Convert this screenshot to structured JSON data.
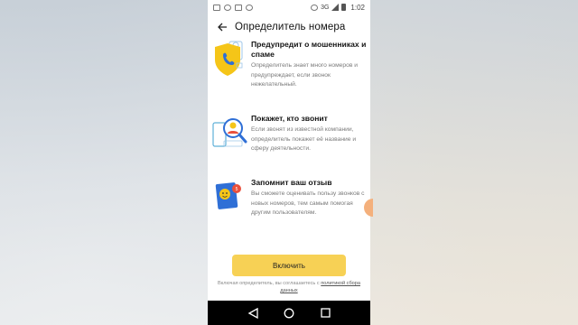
{
  "status_bar": {
    "network": "3G",
    "time": "1:02"
  },
  "app_bar": {
    "title": "Определитель номера",
    "back_icon": "arrow-left-icon"
  },
  "features": [
    {
      "icon": "shield-phone-icon",
      "title": "Предупредит о мошенниках и спаме",
      "description": "Определитель знает много номеров и предупреждает, если звонок нежелательный."
    },
    {
      "icon": "magnifier-person-icon",
      "title": "Покажет, кто звонит",
      "description": "Если звонят из известной компании, определитель покажет её название и сферу деятельности."
    },
    {
      "icon": "smiley-review-icon",
      "title": "Запомнит ваш отзыв",
      "description": "Вы сможете оценивать пользу звонков с новых номеров, тем самым помогая другим пользователям."
    }
  ],
  "cta": {
    "label": "Включить"
  },
  "legal": {
    "text": "Включая определитель, вы соглашаетесь с",
    "link": "политикой сбора данных"
  },
  "colors": {
    "accent": "#f7d155",
    "icon_yellow": "#f5c518",
    "icon_blue": "#2f6fd6",
    "icon_red": "#e9503c"
  }
}
